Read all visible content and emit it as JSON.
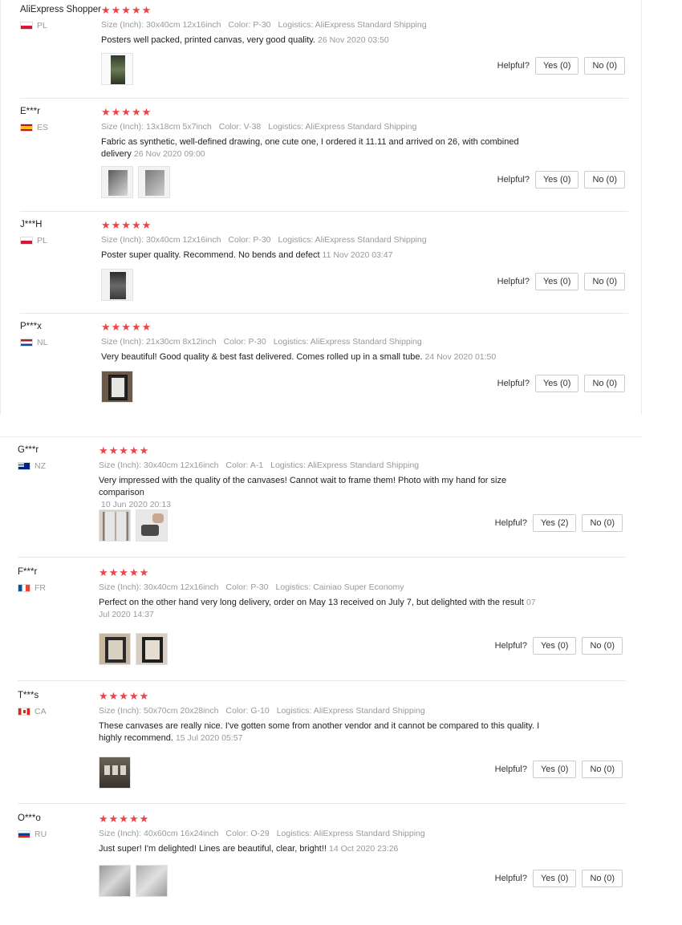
{
  "labels": {
    "helpful": "Helpful?"
  },
  "reviews_top": [
    {
      "user": "AliExpress Shopper",
      "country": "PL",
      "flag": "pl",
      "stars": "★★★★★",
      "size": "Size (Inch): 30x40cm 12x16inch",
      "color": "Color: P-30",
      "logistics": "Logistics: AliExpress Standard Shipping",
      "text": "Posters well packed, printed canvas, very good quality.",
      "date": "26 Nov 2020 03:50",
      "yes": "Yes (0)",
      "no": "No (0)"
    },
    {
      "user": "E***r",
      "country": "ES",
      "flag": "es",
      "stars": "★★★★★",
      "size": "Size (Inch): 13x18cm 5x7inch",
      "color": "Color: V-38",
      "logistics": "Logistics: AliExpress Standard Shipping",
      "text": "Fabric as synthetic, well-defined drawing, one cute one, I ordered it 11.11 and arrived on 26, with combined delivery",
      "date": "26 Nov 2020 09:00",
      "yes": "Yes (0)",
      "no": "No (0)"
    },
    {
      "user": "J***H",
      "country": "PL",
      "flag": "pl",
      "stars": "★★★★★",
      "size": "Size (Inch): 30x40cm 12x16inch",
      "color": "Color: P-30",
      "logistics": "Logistics: AliExpress Standard Shipping",
      "text": "Poster super quality. Recommend. No bends and defect",
      "date": "11 Nov 2020 03:47",
      "yes": "Yes (0)",
      "no": "No (0)"
    },
    {
      "user": "P***x",
      "country": "NL",
      "flag": "nl",
      "stars": "★★★★★",
      "size": "Size (Inch): 21x30cm 8x12inch",
      "color": "Color: P-30",
      "logistics": "Logistics: AliExpress Standard Shipping",
      "text": "Very beautiful! Good quality & best fast delivered. Comes rolled up in a small tube.",
      "date": "24 Nov 2020 01:50",
      "yes": "Yes (0)",
      "no": "No (0)"
    }
  ],
  "reviews_bottom": [
    {
      "user": "G***r",
      "country": "NZ",
      "flag": "nz",
      "stars": "★★★★★",
      "size": "Size (Inch): 30x40cm 12x16inch",
      "color": "Color: A-1",
      "logistics": "Logistics: AliExpress Standard Shipping",
      "text": "Very impressed with the quality of the canvases! Cannot wait to frame them! Photo with my hand for size comparison",
      "date": "10 Jun 2020 20:13",
      "yes": "Yes (2)",
      "no": "No (0)"
    },
    {
      "user": "F***r",
      "country": "FR",
      "flag": "fr",
      "stars": "★★★★★",
      "size": "Size (Inch): 30x40cm 12x16inch",
      "color": "Color: P-30",
      "logistics": "Logistics: Cainiao Super Economy",
      "text": "Perfect on the other hand very long delivery, order on May 13 received on July 7, but delighted with the result",
      "date": "07 Jul 2020 14:37",
      "yes": "Yes (0)",
      "no": "No (0)"
    },
    {
      "user": "T***s",
      "country": "CA",
      "flag": "ca",
      "stars": "★★★★★",
      "size": "Size (Inch): 50x70cm 20x28inch",
      "color": "Color: G-10",
      "logistics": "Logistics: AliExpress Standard Shipping",
      "text": "These canvases are really nice. I've gotten some from another vendor and it cannot be compared to this quality. I highly recommend.",
      "date": "15 Jul 2020 05:57",
      "yes": "Yes (0)",
      "no": "No (0)"
    },
    {
      "user": "O***o",
      "country": "RU",
      "flag": "ru",
      "stars": "★★★★★",
      "size": "Size (Inch): 40x60cm 16x24inch",
      "color": "Color: O-29",
      "logistics": "Logistics: AliExpress Standard Shipping",
      "text": "Just super! I'm delighted! Lines are beautiful, clear, bright!!",
      "date": "14 Oct 2020 23:26",
      "yes": "Yes (0)",
      "no": "No (0)"
    }
  ]
}
